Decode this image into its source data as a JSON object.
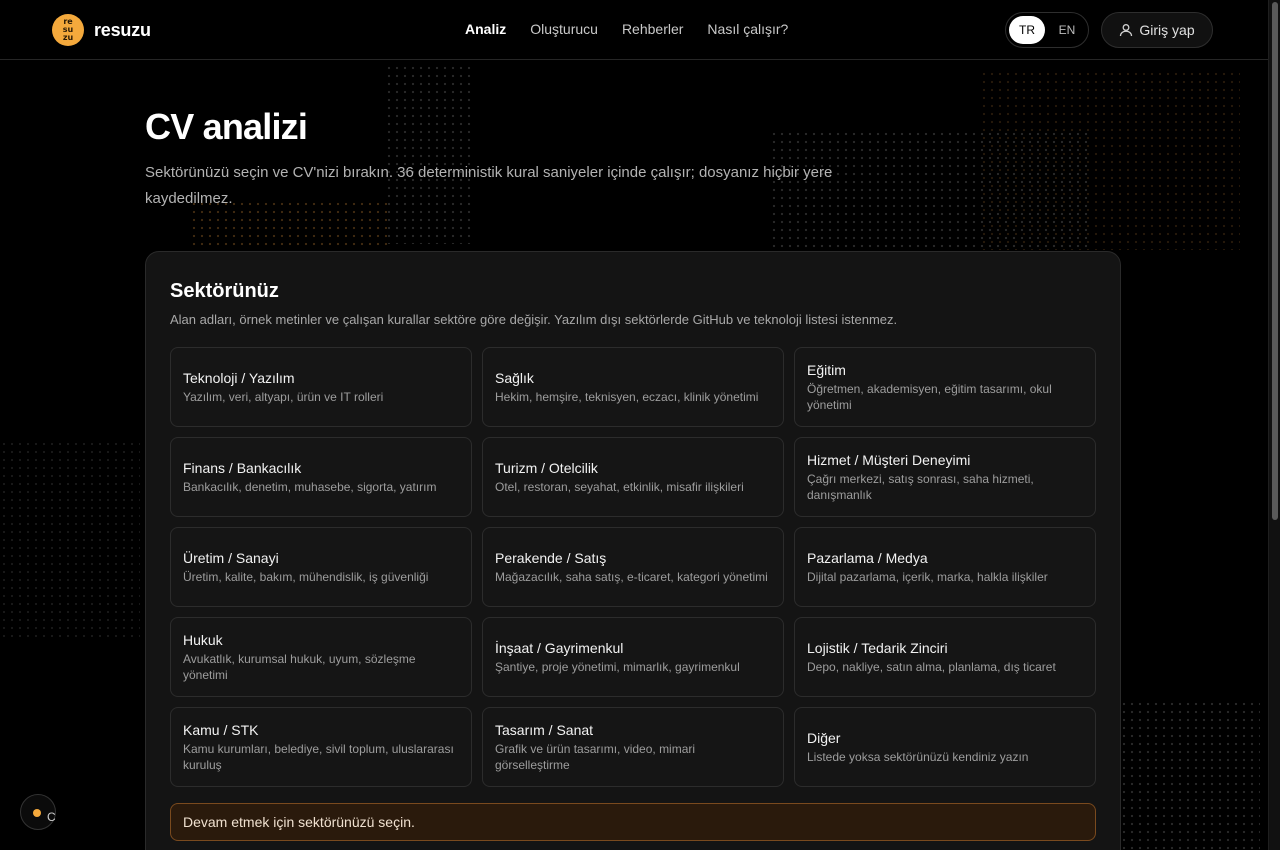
{
  "brand": {
    "name": "resuzu",
    "mark_lines": [
      "re",
      "su",
      "zu"
    ],
    "accent": "#f4a93c"
  },
  "nav": [
    {
      "label": "Analiz",
      "active": true
    },
    {
      "label": "Oluşturucu",
      "active": false
    },
    {
      "label": "Rehberler",
      "active": false
    },
    {
      "label": "Nasıl çalışır?",
      "active": false
    }
  ],
  "lang": {
    "tr": "TR",
    "en": "EN",
    "selected": "TR"
  },
  "login": {
    "label": "Giriş yap",
    "icon": "user-icon"
  },
  "page": {
    "title": "CV analizi",
    "lead": "Sektörünüzü seçin ve CV'nizi bırakın. 36 deterministik kural saniyeler içinde çalışır; dosyanız hiçbir yere kaydedilmez."
  },
  "sector": {
    "heading": "Sektörünüz",
    "description": "Alan adları, örnek metinler ve çalışan kurallar sektöre göre değişir. Yazılım dışı sektörlerde GitHub ve teknoloji listesi istenmez.",
    "options": [
      {
        "title": "Teknoloji / Yazılım",
        "desc": "Yazılım, veri, altyapı, ürün ve IT rolleri"
      },
      {
        "title": "Sağlık",
        "desc": "Hekim, hemşire, teknisyen, eczacı, klinik yönetimi"
      },
      {
        "title": "Eğitim",
        "desc": "Öğretmen, akademisyen, eğitim tasarımı, okul yönetimi"
      },
      {
        "title": "Finans / Bankacılık",
        "desc": "Bankacılık, denetim, muhasebe, sigorta, yatırım"
      },
      {
        "title": "Turizm / Otelcilik",
        "desc": "Otel, restoran, seyahat, etkinlik, misafir ilişkileri"
      },
      {
        "title": "Hizmet / Müşteri Deneyimi",
        "desc": "Çağrı merkezi, satış sonrası, saha hizmeti, danışmanlık"
      },
      {
        "title": "Üretim / Sanayi",
        "desc": "Üretim, kalite, bakım, mühendislik, iş güvenliği"
      },
      {
        "title": "Perakende / Satış",
        "desc": "Mağazacılık, saha satış, e-ticaret, kategori yönetimi"
      },
      {
        "title": "Pazarlama / Medya",
        "desc": "Dijital pazarlama, içerik, marka, halkla ilişkiler"
      },
      {
        "title": "Hukuk",
        "desc": "Avukatlık, kurumsal hukuk, uyum, sözleşme yönetimi"
      },
      {
        "title": "İnşaat / Gayrimenkul",
        "desc": "Şantiye, proje yönetimi, mimarlık, gayrimenkul"
      },
      {
        "title": "Lojistik / Tedarik Zinciri",
        "desc": "Depo, nakliye, satın alma, planlama, dış ticaret"
      },
      {
        "title": "Kamu / STK",
        "desc": "Kamu kurumları, belediye, sivil toplum, uluslararası kuruluş"
      },
      {
        "title": "Tasarım / Sanat",
        "desc": "Grafik ve ürün tasarımı, video, mimari görselleştirme"
      },
      {
        "title": "Diğer",
        "desc": "Listede yoksa sektörünüzü kendiniz yazın"
      }
    ],
    "warning": "Devam etmek için sektörünüzü seçin."
  },
  "fab": {
    "label": "C"
  }
}
